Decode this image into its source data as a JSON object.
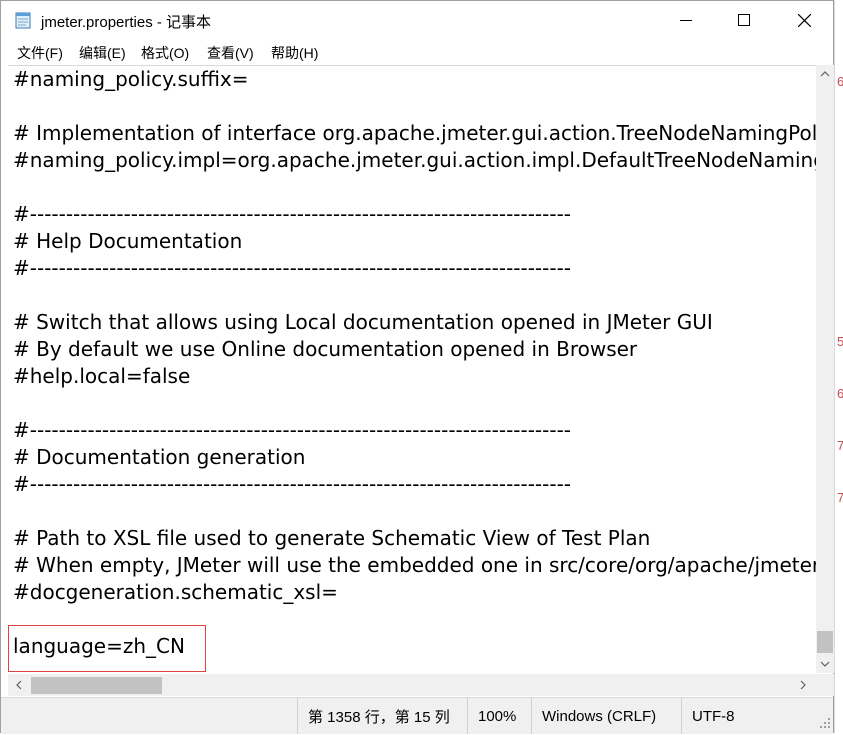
{
  "window": {
    "title": "jmeter.properties - 记事本",
    "minimize_label": "Minimize",
    "maximize_label": "Maximize",
    "close_label": "Close"
  },
  "menu": {
    "items": [
      "文件(F)",
      "编辑(E)",
      "格式(O)",
      "查看(V)",
      "帮助(H)"
    ]
  },
  "editor": {
    "lines": [
      "#naming_policy.suffix=",
      "",
      "# Implementation of interface org.apache.jmeter.gui.action.TreeNodeNamingPolicy",
      "#naming_policy.impl=org.apache.jmeter.gui.action.impl.DefaultTreeNodeNamingPolicy",
      "",
      "#---------------------------------------------------------------------------",
      "# Help Documentation",
      "#---------------------------------------------------------------------------",
      "",
      "# Switch that allows using Local documentation opened in JMeter GUI",
      "# By default we use Online documentation opened in Browser",
      "#help.local=false",
      "",
      "#---------------------------------------------------------------------------",
      "# Documentation generation",
      "#---------------------------------------------------------------------------",
      "",
      "# Path to XSL file used to generate Schematic View of Test Plan",
      "# When empty, JMeter will use the embedded one in src/core/org/apache/jmeter/gui/action/schematic.xsl",
      "#docgeneration.schematic_xsl=",
      "",
      "language=zh_CN"
    ]
  },
  "statusbar": {
    "position": "第 1358 行，第 15 列",
    "zoom": "100%",
    "line_endings": "Windows (CRLF)",
    "encoding": "UTF-8"
  },
  "background_window": {
    "fragments": [
      "6",
      "5",
      "6",
      "7",
      "7"
    ]
  },
  "colors": {
    "highlight_border": "#e0433d",
    "scrollbar_thumb": "#c2c2c2",
    "statusbar_bg": "#f0f0f0"
  },
  "icons": [
    "notepad-icon",
    "minimize-icon",
    "maximize-icon",
    "close-icon",
    "scroll-up-icon",
    "scroll-down-icon",
    "scroll-left-icon",
    "scroll-right-icon",
    "size-grip-icon"
  ]
}
